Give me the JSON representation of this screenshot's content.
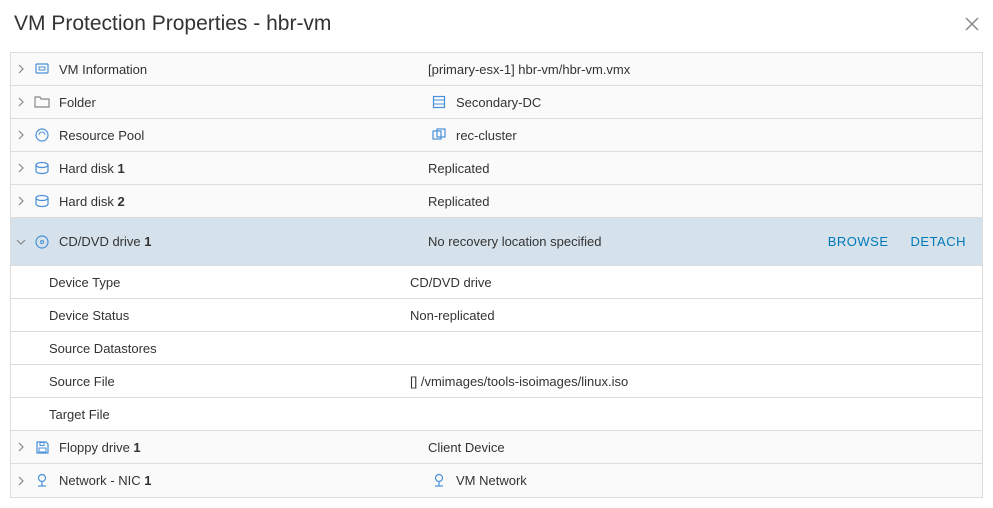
{
  "dialog": {
    "title": "VM Protection Properties - hbr-vm"
  },
  "rows": {
    "vm_info": {
      "label": "VM Information",
      "value": "[primary-esx-1] hbr-vm/hbr-vm.vmx"
    },
    "folder": {
      "label": "Folder",
      "value": "Secondary-DC"
    },
    "resource_pool": {
      "label": "Resource Pool",
      "value": "rec-cluster"
    },
    "hard_disk_1": {
      "label_prefix": "Hard disk ",
      "label_num": "1",
      "value": "Replicated"
    },
    "hard_disk_2": {
      "label_prefix": "Hard disk ",
      "label_num": "2",
      "value": "Replicated"
    },
    "cd_dvd": {
      "label_prefix": "CD/DVD drive ",
      "label_num": "1",
      "value": "No recovery location specified",
      "browse": "BROWSE",
      "detach": "DETACH"
    },
    "floppy": {
      "label_prefix": "Floppy drive ",
      "label_num": "1",
      "value": "Client Device"
    },
    "network": {
      "label_prefix": "Network - NIC ",
      "label_num": "1",
      "value": "VM Network"
    }
  },
  "detail": {
    "device_type": {
      "label": "Device Type",
      "value": "CD/DVD drive"
    },
    "device_status": {
      "label": "Device Status",
      "value": "Non-replicated"
    },
    "source_datastores": {
      "label": "Source Datastores",
      "value": ""
    },
    "source_file": {
      "label": "Source File",
      "value": "[] /vmimages/tools-isoimages/linux.iso"
    },
    "target_file": {
      "label": "Target File",
      "value": ""
    }
  }
}
